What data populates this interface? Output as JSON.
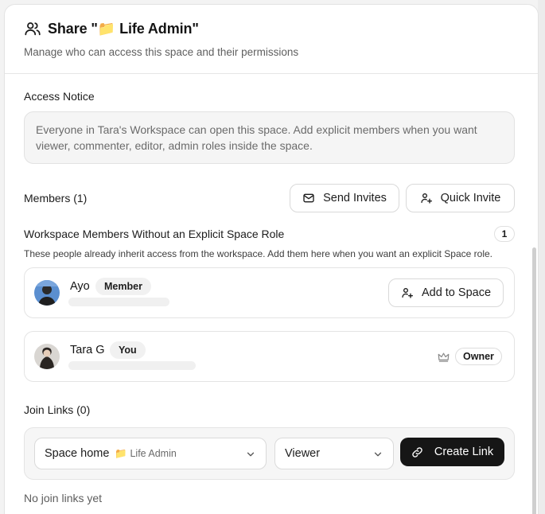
{
  "dialog": {
    "title": "Share \"📁 Life Admin\"",
    "subtitle": "Manage who can access this space and their permissions"
  },
  "access_notice": {
    "label": "Access Notice",
    "text": "Everyone in Tara's Workspace can open this space. Add explicit members when you want viewer, commenter, editor, admin roles inside the space."
  },
  "members": {
    "label": "Members (1)",
    "send_invites_label": "Send Invites",
    "quick_invite_label": "Quick Invite"
  },
  "workspace_members": {
    "heading": "Workspace Members Without an Explicit Space Role",
    "count": "1",
    "helper": "These people already inherit access from the workspace. Add them here when you want an explicit Space role.",
    "items": [
      {
        "name": "Ayo",
        "badge": "Member",
        "action_label": "Add to Space"
      }
    ]
  },
  "space_members": [
    {
      "name": "Tara G",
      "badge": "You",
      "role": "Owner",
      "role_icon": "crown-icon"
    }
  ],
  "join_links": {
    "label": "Join Links (0)",
    "target_select": {
      "value": "Space home",
      "sub_value": "📁 Life Admin"
    },
    "role_select": {
      "value": "Viewer"
    },
    "create_label": "Create Link",
    "empty_text": "No join links yet"
  },
  "colors": {
    "primary_button": "#161616",
    "border": "#e4e4e4",
    "muted_text": "#6b6b6b"
  }
}
